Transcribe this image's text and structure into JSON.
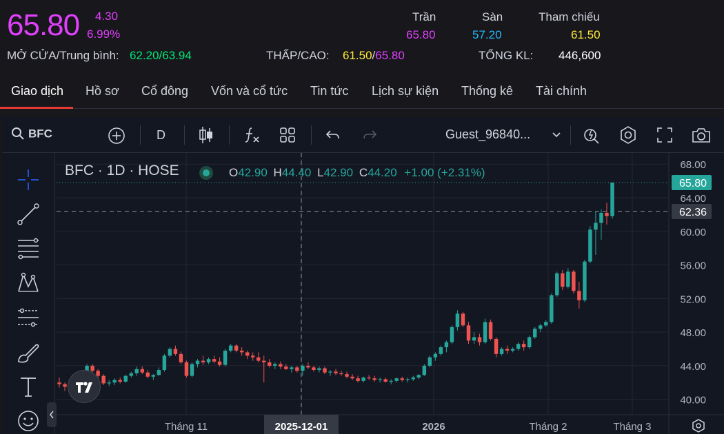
{
  "quote": {
    "price": "65.80",
    "change": "4.30",
    "change_pct": "6.99%",
    "ceiling_label": "Trần",
    "ceiling": "65.80",
    "floor_label": "Sàn",
    "floor": "57.20",
    "ref_label": "Tham chiếu",
    "ref": "61.50",
    "open_avg_label": "MỞ CỬA/Trung bình:",
    "open": "62.20",
    "avg": "63.94",
    "lowhigh_label": "THẤP/CAO:",
    "low": "61.50",
    "high": "65.80",
    "volume_label": "TỔNG KL:",
    "volume": "446,600",
    "sep": "/"
  },
  "tabs": [
    {
      "label": "Giao dịch"
    },
    {
      "label": "Hồ sơ"
    },
    {
      "label": "Cổ đông"
    },
    {
      "label": "Vốn và cổ tức"
    },
    {
      "label": "Tin tức"
    },
    {
      "label": "Lịch sự kiện"
    },
    {
      "label": "Thống kê"
    },
    {
      "label": "Tài chính"
    }
  ],
  "toolbar": {
    "symbol": "BFC",
    "interval": "D",
    "user": "Guest_96840..."
  },
  "legend": {
    "title": "BFC · 1D · HOSE",
    "o_label": "O",
    "o": "42.90",
    "h_label": "H",
    "h": "44.40",
    "l_label": "L",
    "l": "42.90",
    "c_label": "C",
    "c": "44.20",
    "change": "+1.00 (+2.31%)"
  },
  "colors": {
    "up": "#26a69a",
    "down": "#ef5350",
    "accent_magenta": "#e040fb",
    "cyan": "#29b6f6",
    "yellow": "#ffeb3b",
    "green": "#00e676"
  },
  "chart_data": {
    "type": "candlestick",
    "ylim": [
      38.5,
      69
    ],
    "y_ticks": [
      "68.00",
      "64.00",
      "60.00",
      "56.00",
      "52.00",
      "48.00",
      "44.00",
      "40.00"
    ],
    "x_labels": [
      "Tháng 11",
      "2025-12-01",
      "2026",
      "Tháng 2",
      "Tháng 3"
    ],
    "last_price_label": "65.80",
    "crosshair_price_label": "62.36",
    "last_price": 65.8,
    "crosshair_price": 62.36,
    "candles": [
      [
        42.0,
        42.6,
        41.4,
        41.8
      ],
      [
        41.8,
        42.0,
        41.0,
        41.5
      ],
      [
        41.5,
        41.9,
        40.8,
        41.7
      ],
      [
        41.7,
        42.4,
        41.5,
        42.2
      ],
      [
        42.2,
        43.4,
        42.0,
        43.2
      ],
      [
        43.2,
        44.2,
        42.9,
        44.0
      ],
      [
        44.0,
        44.2,
        43.1,
        43.4
      ],
      [
        43.4,
        43.6,
        42.6,
        42.8
      ],
      [
        42.8,
        43.0,
        41.7,
        41.9
      ],
      [
        41.9,
        42.3,
        41.6,
        42.0
      ],
      [
        42.0,
        42.5,
        41.7,
        42.3
      ],
      [
        42.3,
        42.6,
        41.9,
        42.1
      ],
      [
        42.1,
        42.9,
        42.0,
        42.8
      ],
      [
        42.8,
        43.3,
        42.6,
        43.1
      ],
      [
        43.1,
        43.9,
        42.8,
        43.6
      ],
      [
        43.6,
        43.9,
        43.0,
        43.2
      ],
      [
        43.2,
        43.5,
        42.5,
        42.7
      ],
      [
        42.7,
        43.0,
        42.3,
        42.9
      ],
      [
        42.9,
        43.8,
        42.8,
        43.5
      ],
      [
        43.5,
        45.4,
        43.3,
        45.2
      ],
      [
        45.2,
        46.2,
        45.0,
        46.0
      ],
      [
        46.0,
        46.4,
        45.2,
        45.4
      ],
      [
        45.4,
        45.7,
        44.2,
        44.4
      ],
      [
        44.4,
        44.6,
        42.6,
        42.8
      ],
      [
        42.8,
        44.4,
        42.6,
        44.2
      ],
      [
        44.2,
        44.8,
        43.8,
        44.6
      ],
      [
        44.6,
        45.2,
        44.1,
        44.4
      ],
      [
        44.4,
        45.0,
        44.2,
        44.8
      ],
      [
        44.8,
        45.2,
        44.3,
        44.5
      ],
      [
        44.5,
        45.0,
        43.9,
        44.1
      ],
      [
        44.1,
        46.0,
        43.9,
        45.8
      ],
      [
        45.8,
        46.6,
        45.6,
        46.4
      ],
      [
        46.4,
        46.6,
        45.6,
        45.8
      ],
      [
        45.8,
        46.2,
        45.2,
        45.6
      ],
      [
        45.6,
        45.8,
        44.8,
        45.2
      ],
      [
        45.2,
        45.6,
        44.6,
        45.0
      ],
      [
        45.0,
        45.6,
        44.4,
        44.6
      ],
      [
        44.6,
        45.2,
        42.0,
        44.4
      ],
      [
        44.4,
        44.8,
        43.8,
        44.0
      ],
      [
        44.0,
        44.4,
        43.6,
        44.2
      ],
      [
        44.2,
        44.5,
        43.6,
        43.9
      ],
      [
        43.9,
        44.2,
        43.5,
        43.6
      ],
      [
        43.6,
        44.0,
        43.2,
        43.8
      ],
      [
        43.8,
        44.0,
        43.2,
        43.4
      ],
      [
        43.4,
        44.2,
        42.8,
        44.0
      ],
      [
        44.0,
        44.4,
        43.6,
        43.8
      ],
      [
        43.8,
        44.0,
        43.3,
        43.5
      ],
      [
        43.5,
        43.9,
        43.2,
        43.7
      ],
      [
        43.7,
        43.9,
        43.0,
        43.2
      ],
      [
        43.2,
        43.5,
        42.8,
        43.3
      ],
      [
        43.3,
        43.6,
        42.9,
        43.1
      ],
      [
        43.1,
        43.4,
        42.8,
        43.0
      ],
      [
        43.0,
        43.3,
        42.5,
        42.7
      ],
      [
        42.7,
        43.0,
        42.3,
        42.5
      ],
      [
        42.5,
        42.8,
        42.0,
        42.2
      ],
      [
        42.2,
        42.7,
        42.0,
        42.6
      ],
      [
        42.6,
        42.9,
        42.3,
        42.5
      ],
      [
        42.5,
        42.8,
        42.1,
        42.3
      ],
      [
        42.3,
        42.6,
        42.0,
        42.4
      ],
      [
        42.4,
        42.6,
        42.0,
        42.1
      ],
      [
        42.1,
        42.4,
        41.8,
        42.2
      ],
      [
        42.2,
        42.6,
        42.0,
        42.5
      ],
      [
        42.5,
        42.7,
        42.1,
        42.3
      ],
      [
        42.3,
        42.6,
        42.0,
        42.4
      ],
      [
        42.4,
        42.8,
        42.2,
        42.6
      ],
      [
        42.6,
        43.0,
        42.4,
        42.9
      ],
      [
        42.9,
        44.2,
        42.8,
        44.0
      ],
      [
        44.0,
        45.2,
        43.8,
        45.0
      ],
      [
        45.0,
        45.6,
        44.6,
        45.4
      ],
      [
        45.4,
        46.4,
        45.2,
        46.2
      ],
      [
        46.2,
        47.0,
        45.6,
        46.8
      ],
      [
        46.8,
        48.8,
        46.6,
        48.6
      ],
      [
        48.6,
        50.6,
        48.2,
        50.2
      ],
      [
        50.2,
        50.4,
        48.6,
        48.8
      ],
      [
        48.8,
        49.2,
        46.6,
        47.0
      ],
      [
        47.0,
        48.0,
        46.6,
        47.4
      ],
      [
        47.4,
        47.8,
        46.4,
        46.8
      ],
      [
        46.8,
        49.6,
        46.6,
        49.2
      ],
      [
        49.2,
        49.5,
        47.0,
        47.2
      ],
      [
        47.2,
        47.4,
        45.0,
        45.4
      ],
      [
        45.4,
        46.2,
        45.2,
        46.0
      ],
      [
        46.0,
        46.4,
        45.4,
        45.8
      ],
      [
        45.8,
        46.2,
        45.6,
        46.0
      ],
      [
        46.0,
        46.8,
        45.8,
        46.6
      ],
      [
        46.6,
        47.0,
        45.8,
        46.2
      ],
      [
        46.2,
        47.6,
        46.0,
        47.4
      ],
      [
        47.4,
        48.6,
        47.2,
        48.4
      ],
      [
        48.4,
        49.0,
        48.0,
        48.8
      ],
      [
        48.8,
        49.4,
        48.6,
        49.2
      ],
      [
        49.2,
        52.6,
        49.0,
        52.4
      ],
      [
        52.4,
        55.2,
        52.2,
        55.0
      ],
      [
        55.0,
        55.4,
        53.0,
        53.4
      ],
      [
        53.4,
        55.6,
        53.2,
        55.2
      ],
      [
        55.2,
        55.4,
        52.6,
        52.9
      ],
      [
        52.9,
        54.0,
        50.8,
        51.8
      ],
      [
        51.8,
        56.6,
        51.6,
        56.4
      ],
      [
        56.4,
        60.6,
        56.2,
        60.2
      ],
      [
        60.2,
        62.4,
        57.2,
        61.0
      ],
      [
        61.0,
        62.6,
        59.0,
        62.2
      ],
      [
        62.2,
        63.4,
        60.8,
        61.8
      ],
      [
        61.8,
        65.8,
        61.5,
        65.8
      ]
    ]
  }
}
